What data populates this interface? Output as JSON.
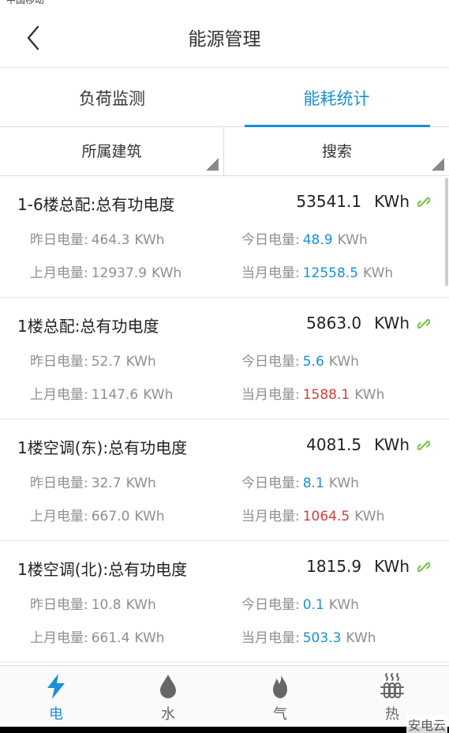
{
  "status": {
    "carrier": "中国移动"
  },
  "header": {
    "title": "能源管理"
  },
  "tabs": [
    {
      "label": "负荷监测",
      "active": false
    },
    {
      "label": "能耗统计",
      "active": true
    }
  ],
  "filters": [
    {
      "label": "所属建筑"
    },
    {
      "label": "搜索"
    }
  ],
  "colors": {
    "accent": "#1a8fd6",
    "alert": "#d43c3c",
    "link": "#7cc34a"
  },
  "records": [
    {
      "name": "1-6楼总配:总有功电度",
      "total": "53541.1",
      "unit": "KWh",
      "yesterday_label": "昨日电量:",
      "yesterday": "464.3",
      "today_label": "今日电量:",
      "today": "48.9",
      "last_month_label": "上月电量:",
      "last_month": "12937.9",
      "this_month_label": "当月电量:",
      "this_month": "12558.5",
      "this_month_status": "normal"
    },
    {
      "name": "1楼总配:总有功电度",
      "total": "5863.0",
      "unit": "KWh",
      "yesterday_label": "昨日电量:",
      "yesterday": "52.7",
      "today_label": "今日电量:",
      "today": "5.6",
      "last_month_label": "上月电量:",
      "last_month": "1147.6",
      "this_month_label": "当月电量:",
      "this_month": "1588.1",
      "this_month_status": "over"
    },
    {
      "name": "1楼空调(东):总有功电度",
      "total": "4081.5",
      "unit": "KWh",
      "yesterday_label": "昨日电量:",
      "yesterday": "32.7",
      "today_label": "今日电量:",
      "today": "8.1",
      "last_month_label": "上月电量:",
      "last_month": "667.0",
      "this_month_label": "当月电量:",
      "this_month": "1064.5",
      "this_month_status": "over"
    },
    {
      "name": "1楼空调(北):总有功电度",
      "total": "1815.9",
      "unit": "KWh",
      "yesterday_label": "昨日电量:",
      "yesterday": "10.8",
      "today_label": "今日电量:",
      "today": "0.1",
      "last_month_label": "上月电量:",
      "last_month": "661.4",
      "this_month_label": "当月电量:",
      "this_month": "503.3",
      "this_month_status": "normal"
    }
  ],
  "bottom_nav": [
    {
      "label": "电",
      "icon": "lightning-icon",
      "active": true
    },
    {
      "label": "水",
      "icon": "water-drop-icon",
      "active": false
    },
    {
      "label": "气",
      "icon": "flame-icon",
      "active": false
    },
    {
      "label": "热",
      "icon": "radiator-icon",
      "active": false
    }
  ],
  "watermark": "安电云"
}
